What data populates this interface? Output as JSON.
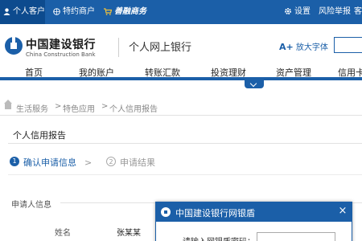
{
  "topbar": {
    "personal": "个人客户",
    "merchant": "特约商户",
    "shan_rong": "善融商务",
    "settings": "设置",
    "risk_report": "风险举报",
    "service": "客"
  },
  "header": {
    "logo_cn": "中国建设银行",
    "logo_en": "China Construction Bank",
    "title": "个人网上银行",
    "font_toggle": "放大字体",
    "font_toggle_prefix": "A+"
  },
  "nav": {
    "items": [
      "首页",
      "我的账户",
      "转账汇款",
      "投资理财",
      "资产管理",
      "信用卡"
    ]
  },
  "breadcrumb": [
    "生活服务",
    "特色应用",
    "个人信用报告"
  ],
  "breadcrumb_sep": ">",
  "page": {
    "title": "个人信用报告"
  },
  "steps": [
    {
      "num": "1",
      "label": "确认申请信息"
    },
    {
      "num": "2",
      "label": "申请结果"
    }
  ],
  "step_arrow": ">",
  "form": {
    "section_label": "申请人信息",
    "name_label": "姓名",
    "name_value": "张某某"
  },
  "dialog": {
    "title": "中国建设银行网银盾",
    "close": "×",
    "prompt": "请输入网银盾密码："
  },
  "colors": {
    "brand_blue": "#1b5fa8",
    "shan_rong_gold": "#f2c23a"
  }
}
